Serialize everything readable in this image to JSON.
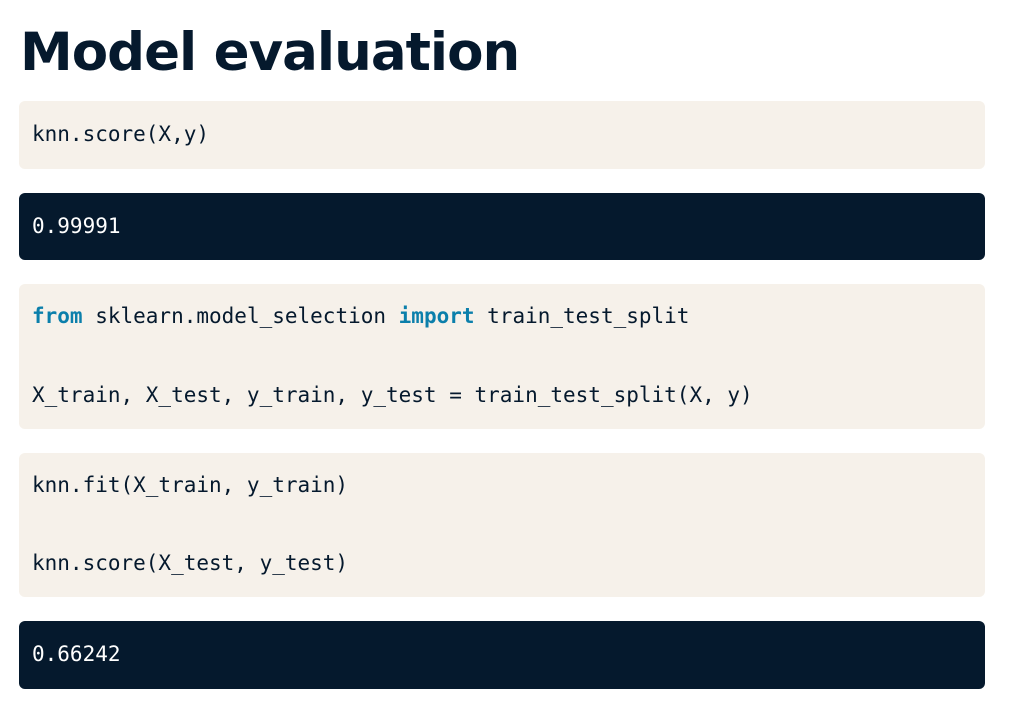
{
  "title": "Model evaluation",
  "cells": [
    {
      "kind": "code",
      "lines": [
        "knn.score(X,y)"
      ]
    },
    {
      "kind": "output",
      "text": "0.99991"
    },
    {
      "kind": "code",
      "import_line": {
        "kw_from": "from",
        "module": " sklearn.model_selection ",
        "kw_import": "import",
        "name": " train_test_split"
      },
      "lines": [
        "X_train, X_test, y_train, y_test = train_test_split(X, y)"
      ]
    },
    {
      "kind": "code",
      "lines": [
        "knn.fit(X_train, y_train)",
        "knn.score(X_test, y_test)"
      ]
    },
    {
      "kind": "output",
      "text": "0.66242"
    }
  ],
  "colors": {
    "title": "#05192d",
    "code_background": "#f6f1ea",
    "output_background": "#05192d",
    "keyword": "#0b7fab"
  }
}
